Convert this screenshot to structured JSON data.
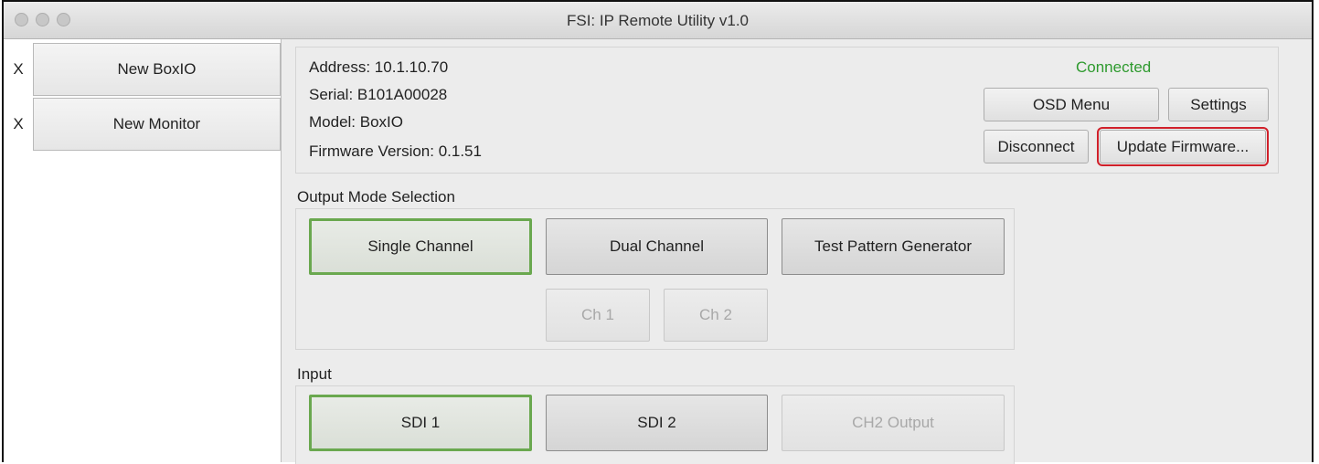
{
  "window": {
    "title": "FSI: IP Remote Utility v1.0"
  },
  "sidebar": {
    "items": [
      {
        "close": "X",
        "label": "New BoxIO"
      },
      {
        "close": "X",
        "label": "New Monitor"
      }
    ]
  },
  "device_info": {
    "address": "Address: 10.1.10.70",
    "serial": "Serial: B101A00028",
    "model": "Model: BoxIO",
    "firmware": "Firmware Version: 0.1.51",
    "status": "Connected",
    "status_color": "#2e9a2e",
    "buttons": {
      "osd_menu": "OSD Menu",
      "settings": "Settings",
      "disconnect": "Disconnect",
      "update_firmware": "Update Firmware..."
    },
    "highlight_color": "#d0202a"
  },
  "output_mode": {
    "label": "Output Mode Selection",
    "modes": [
      {
        "label": "Single Channel",
        "selected": true
      },
      {
        "label": "Dual Channel",
        "selected": false
      },
      {
        "label": "Test Pattern Generator",
        "selected": false
      }
    ],
    "channels": [
      {
        "label": "Ch 1",
        "enabled": false
      },
      {
        "label": "Ch 2",
        "enabled": false
      }
    ]
  },
  "input": {
    "label": "Input",
    "options": [
      {
        "label": "SDI 1",
        "selected": true
      },
      {
        "label": "SDI 2",
        "selected": false
      },
      {
        "label": "CH2 Output",
        "enabled": false
      }
    ]
  },
  "colors": {
    "selected_border": "#6aa84f"
  }
}
